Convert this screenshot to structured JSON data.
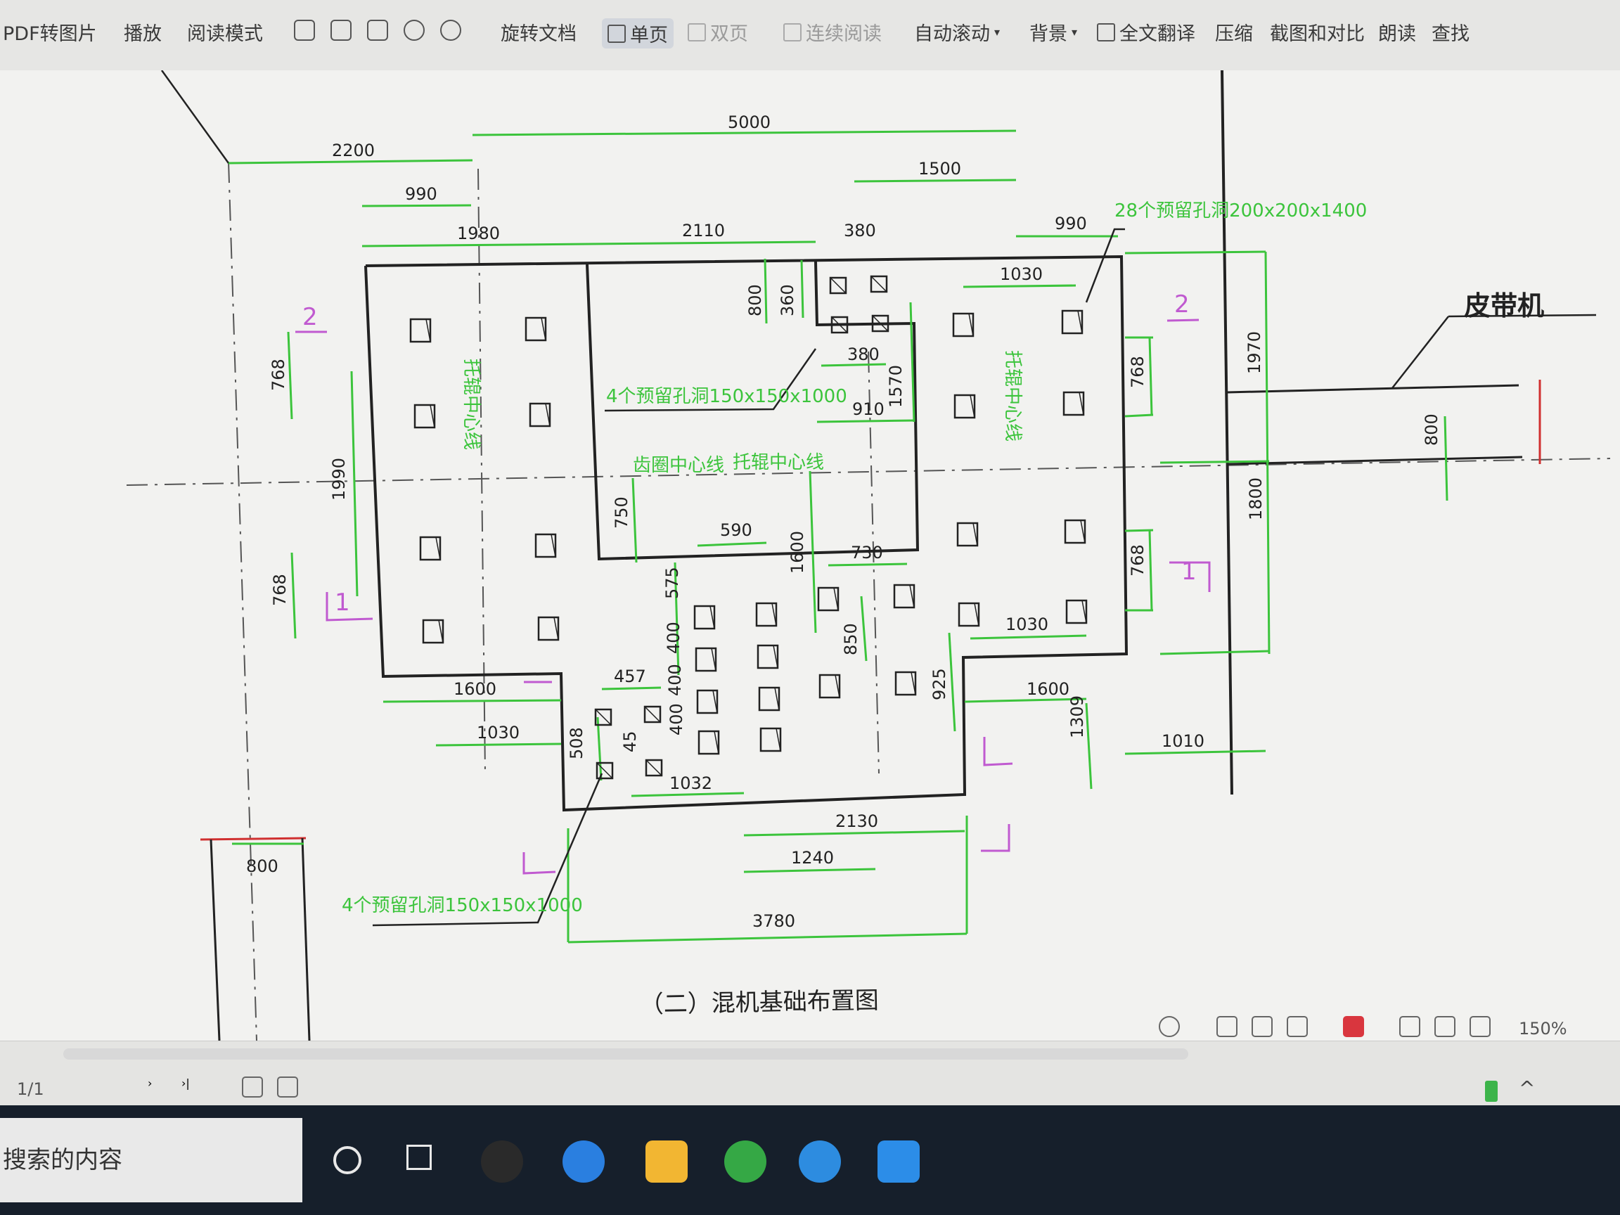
{
  "toolbar": {
    "pdf_to_image": "PDF转图片",
    "play": "播放",
    "reading_mode": "阅读模式",
    "rotate_doc": "旋转文档",
    "single_page": "单页",
    "double_page": "双页",
    "continuous": "连续阅读",
    "auto_scroll": "自动滚动",
    "background": "背景",
    "translate_all": "全文翻译",
    "compress": "压缩",
    "screenshot_compare": "截图和对比",
    "read_aloud": "朗读",
    "find": "查找"
  },
  "drawing": {
    "title_partial": "（二）混机基础布置图",
    "belt_label": "皮带机",
    "note_top": "28个预留孔洞200x200x1400",
    "note_mid": "4个预留孔洞150x150x1000",
    "note_bottom": "4个预留孔洞150x150x1000",
    "centerline_a": "齿圈中心线",
    "centerline_b": "托辊中心线",
    "centerline_vertical": "托辊中心线",
    "section_marks": [
      "2",
      "2",
      "1",
      "1"
    ],
    "dimensions": {
      "d5000": "5000",
      "d2200": "2200",
      "d990a": "990",
      "d1980": "1980",
      "d2110": "2110",
      "d1500": "1500",
      "d380a": "380",
      "d990b": "990",
      "d1030a": "1030",
      "d800a": "800",
      "d360": "360",
      "d380b": "380",
      "d910": "910",
      "d1570": "1570",
      "d768a": "768",
      "d1990": "1990",
      "d768b": "768",
      "d750": "750",
      "d590": "590",
      "d1600a": "1600",
      "d730": "730",
      "d575": "575",
      "d400a": "400",
      "d400b": "400",
      "d400c": "400",
      "d850": "850",
      "d925": "925",
      "d1030b": "1030",
      "d1600b": "1600",
      "d1309": "1309",
      "d1010": "1010",
      "d1600c": "1600",
      "d1030c": "1030",
      "d457": "457",
      "d508": "508",
      "d45": "45",
      "d1032": "1032",
      "d2130": "2130",
      "d1240": "1240",
      "d3780": "3780",
      "d768c": "768",
      "d768d": "768",
      "d1970": "1970",
      "d1800": "1800",
      "d800b": "800",
      "d800c": "800"
    }
  },
  "statusbar": {
    "page_indicator": "1/1",
    "zoom": "150%"
  },
  "taskbar": {
    "search_text": "搜索的内容"
  },
  "colors": {
    "dim_green": "#3cc43c",
    "outline": "#222222",
    "mark_magenta": "#c05ad0",
    "belt_red": "#d03030"
  }
}
